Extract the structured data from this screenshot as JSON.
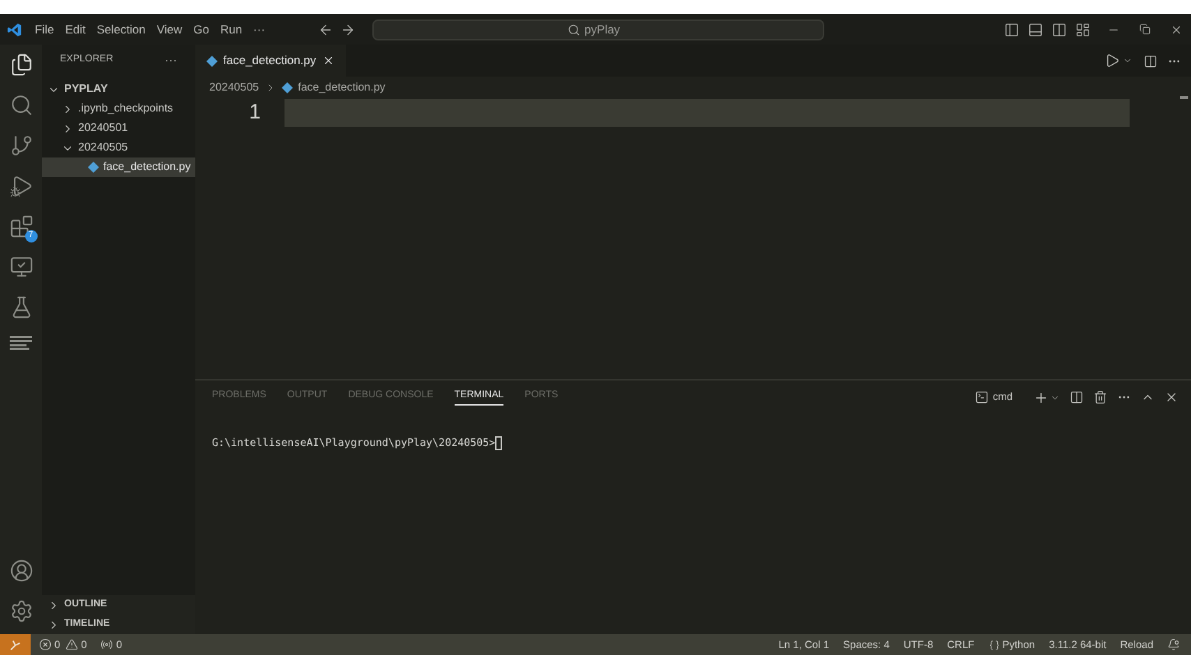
{
  "menu": [
    "File",
    "Edit",
    "Selection",
    "View",
    "Go",
    "Run",
    "···"
  ],
  "command_center": {
    "placeholder": "pyPlay"
  },
  "activity_bar": {
    "extensions_badge": "7"
  },
  "sidebar": {
    "title": "EXPLORER",
    "more": "···",
    "tree": [
      {
        "label": "PYPLAY",
        "kind": "folder",
        "expanded": true,
        "children": [
          {
            "label": ".ipynb_checkpoints",
            "kind": "folder",
            "expanded": false,
            "selected": false
          },
          {
            "label": "20240501",
            "kind": "folder",
            "expanded": false,
            "selected": false
          },
          {
            "label": "20240505",
            "kind": "folder",
            "expanded": true,
            "selected": false,
            "children": [
              {
                "label": "face_detection.py",
                "kind": "file",
                "selected": true
              }
            ]
          }
        ]
      }
    ],
    "sections": [
      {
        "label": "OUTLINE",
        "expanded": false
      },
      {
        "label": "TIMELINE",
        "expanded": false
      }
    ]
  },
  "editor": {
    "tabs": [
      {
        "label": "face_detection.py",
        "selected": true
      }
    ],
    "breadcrumb": [
      "20240505",
      "face_detection.py"
    ],
    "lines": [
      {
        "number": "1"
      }
    ]
  },
  "panel": {
    "tabs": [
      {
        "label": "PROBLEMS",
        "selected": false
      },
      {
        "label": "OUTPUT",
        "selected": false
      },
      {
        "label": "DEBUG CONSOLE",
        "selected": false
      },
      {
        "label": "TERMINAL",
        "selected": true
      },
      {
        "label": "PORTS",
        "selected": false
      }
    ],
    "terminal_name": "cmd",
    "prompt": "G:\\intellisenseAI\\Playground\\pyPlay\\20240505>"
  },
  "status_bar": {
    "errors": "0",
    "warnings": "0",
    "ports": "0",
    "right": [
      {
        "kind": "text",
        "label": "Ln 1, Col 1"
      },
      {
        "kind": "text",
        "label": "Spaces: 4"
      },
      {
        "kind": "text",
        "label": "UTF-8"
      },
      {
        "kind": "text",
        "label": "CRLF"
      },
      {
        "kind": "language",
        "label": "Python"
      },
      {
        "kind": "text",
        "label": "3.11.2 64-bit"
      },
      {
        "kind": "text",
        "label": "Reload"
      }
    ]
  }
}
